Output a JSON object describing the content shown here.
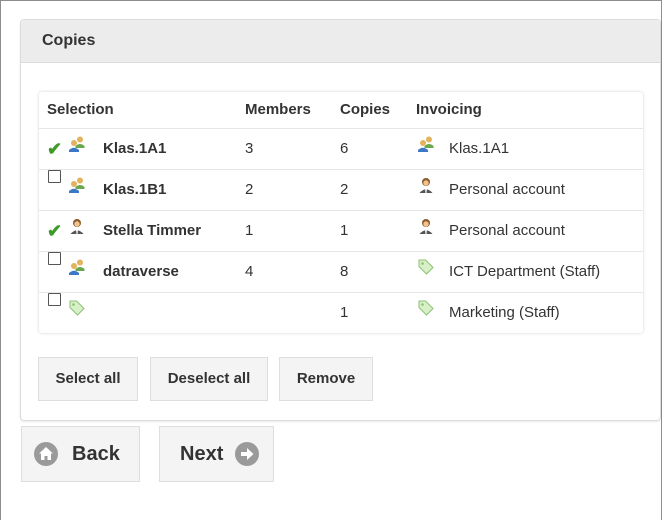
{
  "panel": {
    "title": "Copies"
  },
  "table": {
    "headers": {
      "selection": "Selection",
      "members": "Members",
      "copies": "Copies",
      "invoicing": "Invoicing"
    },
    "rows": [
      {
        "selected": true,
        "type": "group",
        "name": "Klas.1A1",
        "members": "3",
        "copies": "6",
        "invoice_type": "group",
        "invoicing": "Klas.1A1"
      },
      {
        "selected": false,
        "type": "group",
        "name": "Klas.1B1",
        "members": "2",
        "copies": "2",
        "invoice_type": "person",
        "invoicing": "Personal account"
      },
      {
        "selected": true,
        "type": "person",
        "name": "Stella Timmer",
        "members": "1",
        "copies": "1",
        "invoice_type": "person",
        "invoicing": "Personal account"
      },
      {
        "selected": false,
        "type": "group",
        "name": "datraverse",
        "members": "4",
        "copies": "8",
        "invoice_type": "tag",
        "invoicing": "ICT Department (Staff)"
      },
      {
        "selected": false,
        "type": "tag",
        "name": "",
        "members": "",
        "copies": "1",
        "invoice_type": "tag",
        "invoicing": "Marketing (Staff)"
      }
    ]
  },
  "actions": {
    "select_all": "Select all",
    "deselect_all": "Deselect all",
    "remove": "Remove"
  },
  "nav": {
    "back": "Back",
    "next": "Next"
  },
  "colors": {
    "check": "#3e9b2a",
    "header_bg": "#ececec",
    "button_bg": "#f4f4f4",
    "nav_icon": "#9a9a9a"
  }
}
